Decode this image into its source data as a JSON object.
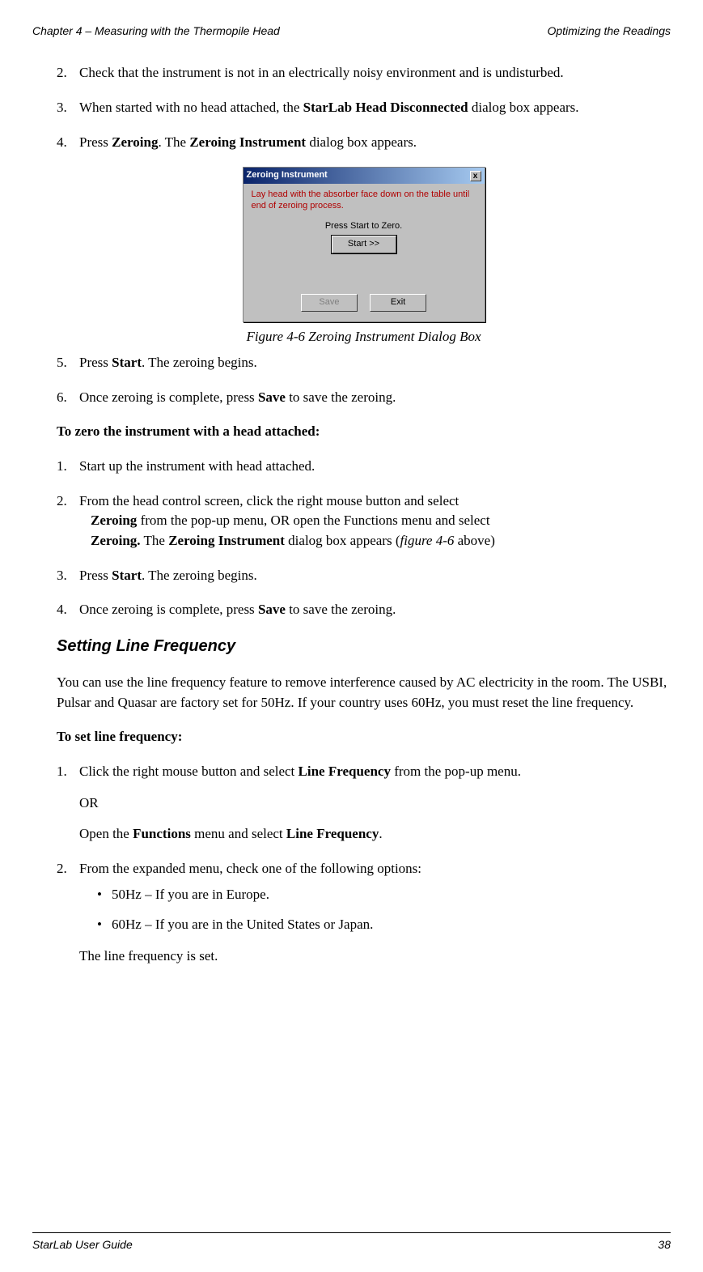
{
  "header": {
    "left": "Chapter 4 – Measuring with the Thermopile Head",
    "right": "Optimizing the Readings"
  },
  "list1": {
    "n2": "2.",
    "t2": "Check that the instrument is not in an electrically noisy environment and is undisturbed.",
    "n3": "3.",
    "t3a": "When started with no head attached, the ",
    "t3b": "StarLab Head Disconnected",
    "t3c": " dialog box appears.",
    "n4": "4.",
    "t4a": "Press ",
    "t4b": "Zeroing",
    "t4c": ". The ",
    "t4d": "Zeroing Instrument",
    "t4e": " dialog box appears."
  },
  "dialog": {
    "title": "Zeroing Instrument",
    "msg": "Lay head with the absorber face down on the table until end of zeroing process.",
    "label": "Press Start to Zero.",
    "start": "Start >>",
    "save": "Save",
    "exit": "Exit"
  },
  "caption": "Figure 4-6 Zeroing Instrument Dialog Box",
  "list2": {
    "n5": "5.",
    "t5a": "Press ",
    "t5b": "Start",
    "t5c": ". The zeroing begins.",
    "n6": "6.",
    "t6a": "Once zeroing is complete, press ",
    "t6b": "Save",
    "t6c": " to save the zeroing."
  },
  "subhead1": "To zero the instrument with a head attached:",
  "list3": {
    "n1": "1.",
    "t1": "Start up the instrument with head attached.",
    "n2": "2.",
    "t2a": "From the head control screen, click the right mouse button and select ",
    "t2b": "Zeroing",
    "t2c": " from the pop-up menu, OR open the Functions menu and select ",
    "t2d": "Zeroing.",
    "t2e": " The ",
    "t2f": "Zeroing Instrument",
    "t2g": " dialog box appears (",
    "t2h": "figure 4-6",
    "t2i": " above)",
    "n3": "3.",
    "t3a": "Press ",
    "t3b": "Start",
    "t3c": ". The zeroing begins.",
    "n4": "4.",
    "t4a": "Once zeroing is complete, press ",
    "t4b": "Save",
    "t4c": " to save the zeroing."
  },
  "h3": "Setting Line Frequency",
  "para1": "You can use the line frequency feature to remove interference caused by AC electricity in the room. The USBI, Pulsar and Quasar are factory set for 50Hz. If your country uses 60Hz, you must reset the line frequency.",
  "subhead2": "To set line frequency:",
  "list4": {
    "n1": "1.",
    "t1a": "Click the right mouse button and select ",
    "t1b": "Line Frequency",
    "t1c": " from the pop-up menu.",
    "or": "OR",
    "t1d": "Open the ",
    "t1e": "Functions",
    "t1f": " menu and select ",
    "t1g": "Line Frequency",
    "t1h": ".",
    "n2": "2.",
    "t2": "From the expanded menu, check one of the following options:",
    "b1": "50Hz – If you are in Europe.",
    "b2": "60Hz – If you are in the United States or Japan.",
    "t2end": "The line frequency is set."
  },
  "footer": {
    "left": "StarLab User Guide",
    "right": "38"
  }
}
